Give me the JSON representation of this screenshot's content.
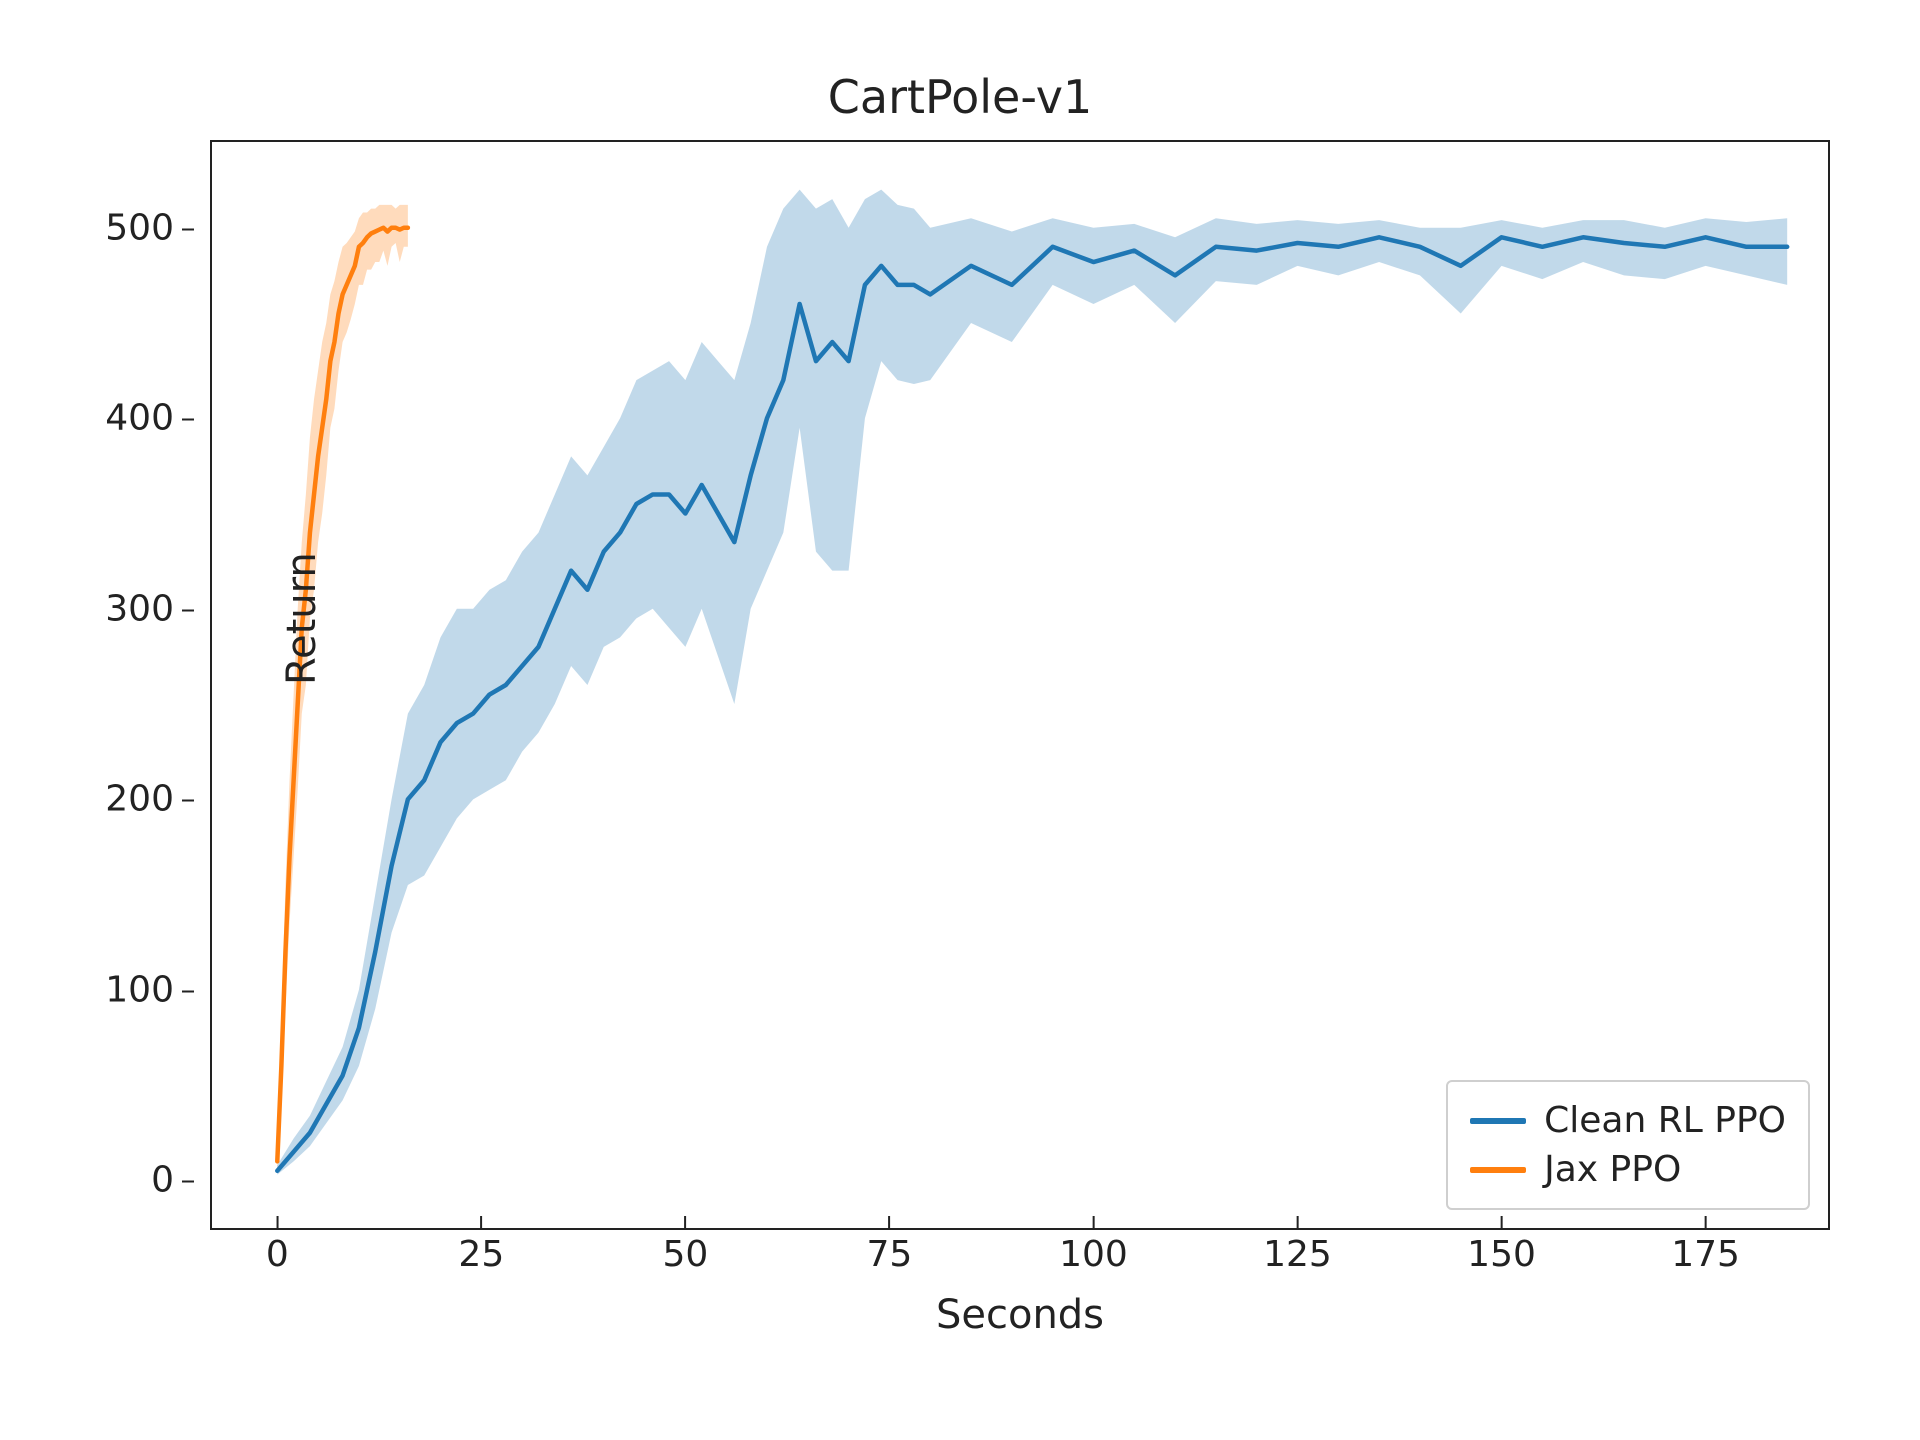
{
  "chart_data": {
    "type": "line",
    "title": "CartPole-v1",
    "xlabel": "Seconds",
    "ylabel": "Return",
    "xlim": [
      -8,
      190
    ],
    "ylim": [
      -25,
      545
    ],
    "xticks": [
      0,
      25,
      50,
      75,
      100,
      125,
      150,
      175
    ],
    "yticks": [
      0,
      100,
      200,
      300,
      400,
      500
    ],
    "legend_position": "lower right",
    "series": [
      {
        "name": "Clean RL PPO",
        "color": "#1f77b4",
        "x": [
          0,
          2,
          4,
          6,
          8,
          10,
          12,
          14,
          16,
          18,
          20,
          22,
          24,
          26,
          28,
          30,
          32,
          34,
          36,
          38,
          40,
          42,
          44,
          46,
          48,
          50,
          52,
          54,
          56,
          58,
          60,
          62,
          64,
          66,
          68,
          70,
          72,
          74,
          76,
          78,
          80,
          85,
          90,
          95,
          100,
          105,
          110,
          115,
          120,
          125,
          130,
          135,
          140,
          145,
          150,
          155,
          160,
          165,
          170,
          175,
          180,
          185
        ],
        "mean": [
          5,
          15,
          25,
          40,
          55,
          80,
          120,
          165,
          200,
          210,
          230,
          240,
          245,
          255,
          260,
          270,
          280,
          300,
          320,
          310,
          330,
          340,
          355,
          360,
          360,
          350,
          365,
          350,
          335,
          370,
          400,
          420,
          460,
          430,
          440,
          430,
          470,
          480,
          470,
          470,
          465,
          480,
          470,
          490,
          482,
          488,
          475,
          490,
          488,
          492,
          490,
          495,
          490,
          480,
          495,
          490,
          495,
          492,
          490,
          495,
          490,
          490
        ],
        "lower": [
          3,
          10,
          18,
          30,
          42,
          60,
          90,
          130,
          155,
          160,
          175,
          190,
          200,
          205,
          210,
          225,
          235,
          250,
          270,
          260,
          280,
          285,
          295,
          300,
          290,
          280,
          300,
          275,
          250,
          300,
          320,
          340,
          395,
          330,
          320,
          320,
          400,
          430,
          420,
          418,
          420,
          450,
          440,
          470,
          460,
          470,
          450,
          472,
          470,
          480,
          475,
          482,
          475,
          455,
          480,
          473,
          482,
          475,
          473,
          480,
          475,
          470
        ],
        "upper": [
          8,
          22,
          34,
          52,
          70,
          100,
          150,
          200,
          245,
          260,
          285,
          300,
          300,
          310,
          315,
          330,
          340,
          360,
          380,
          370,
          385,
          400,
          420,
          425,
          430,
          420,
          440,
          430,
          420,
          450,
          490,
          510,
          520,
          510,
          515,
          500,
          515,
          520,
          512,
          510,
          500,
          505,
          498,
          505,
          500,
          502,
          495,
          505,
          502,
          504,
          502,
          504,
          500,
          500,
          504,
          500,
          504,
          504,
          500,
          505,
          503,
          505
        ]
      },
      {
        "name": "Jax PPO",
        "color": "#ff7f0e",
        "x": [
          0,
          0.5,
          1,
          1.5,
          2,
          2.5,
          3,
          3.5,
          4,
          4.5,
          5,
          5.5,
          6,
          6.5,
          7,
          7.5,
          8,
          8.5,
          9,
          9.5,
          10,
          10.5,
          11,
          11.5,
          12,
          12.5,
          13,
          13.5,
          14,
          14.5,
          15,
          15.5,
          16
        ],
        "mean": [
          10,
          60,
          120,
          170,
          210,
          250,
          290,
          310,
          340,
          360,
          380,
          395,
          410,
          430,
          440,
          455,
          465,
          470,
          475,
          480,
          490,
          492,
          495,
          497,
          498,
          499,
          500,
          498,
          500,
          500,
          499,
          500,
          500
        ],
        "lower": [
          5,
          40,
          90,
          135,
          170,
          205,
          245,
          260,
          295,
          310,
          335,
          350,
          370,
          395,
          405,
          425,
          440,
          445,
          452,
          460,
          470,
          470,
          478,
          478,
          482,
          482,
          488,
          480,
          490,
          492,
          482,
          490,
          490
        ],
        "upper": [
          18,
          85,
          155,
          210,
          255,
          300,
          335,
          360,
          390,
          410,
          425,
          440,
          450,
          465,
          472,
          482,
          490,
          492,
          495,
          498,
          505,
          508,
          508,
          510,
          510,
          512,
          512,
          512,
          512,
          510,
          512,
          512,
          512
        ]
      }
    ]
  },
  "legend": {
    "items": [
      {
        "label": "Clean RL PPO",
        "color": "#1f77b4"
      },
      {
        "label": "Jax PPO",
        "color": "#ff7f0e"
      }
    ]
  }
}
